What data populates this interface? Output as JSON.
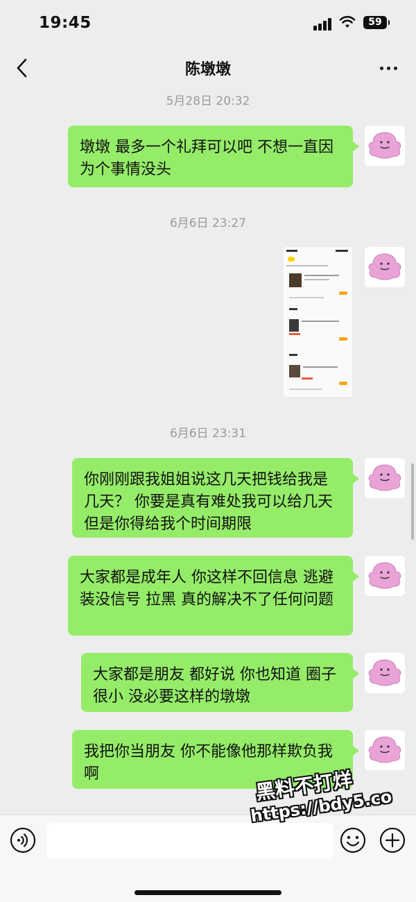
{
  "status_bar": {
    "time": "19:45",
    "battery": "59"
  },
  "chat": {
    "title": "陈墩墩"
  },
  "messages": [
    {
      "type": "timestamp",
      "text": "5月28日 20:32"
    },
    {
      "type": "text",
      "text": "墩墩 最多一个礼拜可以吧 不想一直因为个事情没头"
    },
    {
      "type": "timestamp",
      "text": "6月6日 23:27"
    },
    {
      "type": "image"
    },
    {
      "type": "timestamp",
      "text": "6月6日 23:31"
    },
    {
      "type": "text",
      "text": "你刚刚跟我姐姐说这几天把钱给我是几天？ 你要是真有难处我可以给几天 但是你得给我个时间期限"
    },
    {
      "type": "text",
      "text": "大家都是成年人 你这样不回信息 逃避 装没信号 拉黑 真的解决不了任何问题"
    },
    {
      "type": "text",
      "text": "大家都是朋友 都好说 你也知道 圈子很小 没必要这样的墩墩"
    },
    {
      "type": "text",
      "text": "我把你当朋友 你不能像他那样欺负我啊"
    }
  ],
  "watermark": {
    "line1": "黑料不打烊",
    "line2": "https://bdy5.co"
  },
  "icons": {
    "back": "chevron-left-icon",
    "more": "more-dots-icon",
    "voice": "voice-icon",
    "emoji": "emoji-icon",
    "plus": "plus-icon",
    "avatar": "pink-blob-avatar"
  },
  "colors": {
    "bubble": "#95ec69",
    "background": "#ededed",
    "avatar_pink": "#e9a3d6"
  }
}
